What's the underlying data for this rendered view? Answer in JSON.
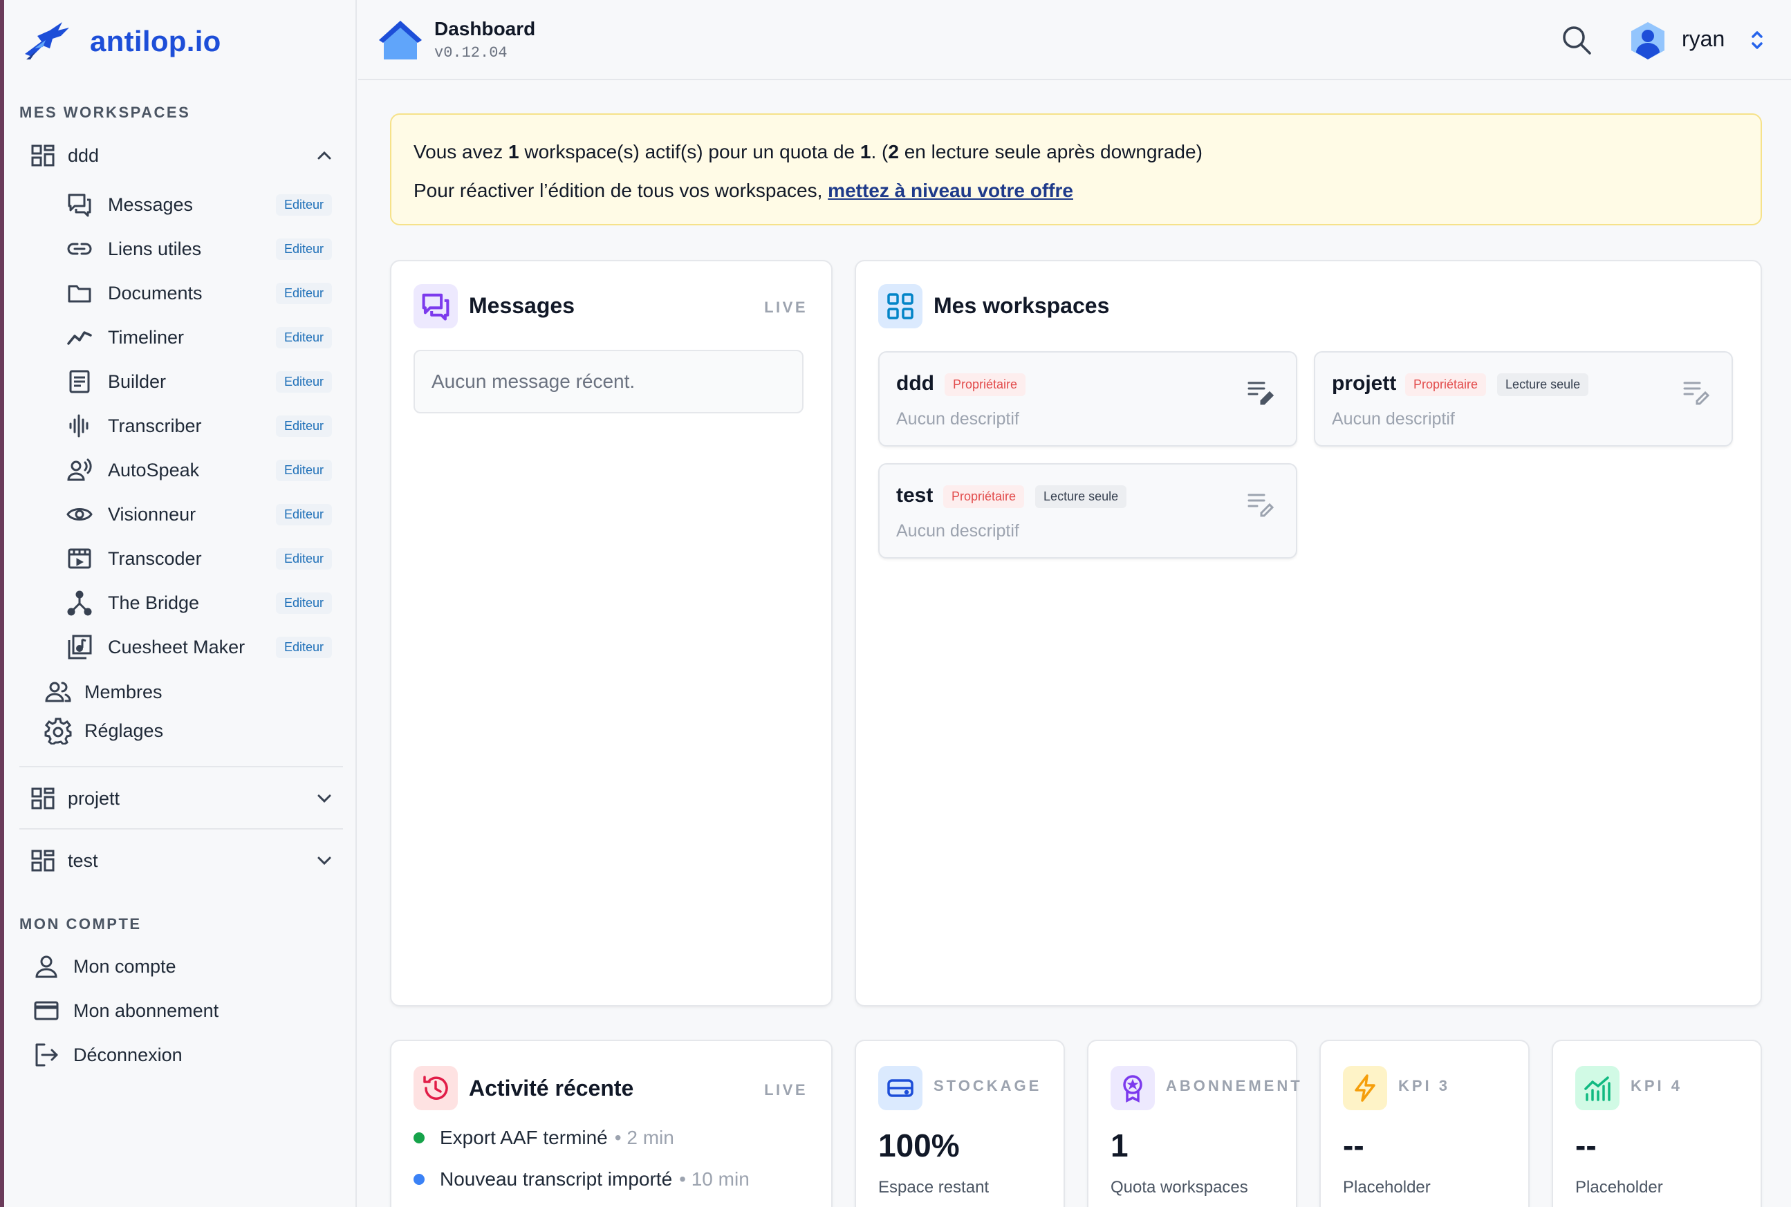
{
  "brand": {
    "name": "antilop.io"
  },
  "sidebar": {
    "workspaces_label": "MES WORKSPACES",
    "account_label": "MON COMPTE",
    "workspaces": [
      {
        "name": "ddd",
        "expanded": true
      },
      {
        "name": "projett",
        "expanded": false
      },
      {
        "name": "test",
        "expanded": false
      }
    ],
    "tools": [
      {
        "label": "Messages",
        "badge": "Editeur",
        "icon": "chat-icon"
      },
      {
        "label": "Liens utiles",
        "badge": "Editeur",
        "icon": "link-icon"
      },
      {
        "label": "Documents",
        "badge": "Editeur",
        "icon": "folder-icon"
      },
      {
        "label": "Timeliner",
        "badge": "Editeur",
        "icon": "trend-icon"
      },
      {
        "label": "Builder",
        "badge": "Editeur",
        "icon": "document-icon"
      },
      {
        "label": "Transcriber",
        "badge": "Editeur",
        "icon": "waveform-icon"
      },
      {
        "label": "AutoSpeak",
        "badge": "Editeur",
        "icon": "speaking-user-icon"
      },
      {
        "label": "Visionneur",
        "badge": "Editeur",
        "icon": "eye-icon"
      },
      {
        "label": "Transcoder",
        "badge": "Editeur",
        "icon": "film-icon"
      },
      {
        "label": "The Bridge",
        "badge": "Editeur",
        "icon": "network-icon"
      },
      {
        "label": "Cuesheet Maker",
        "badge": "Editeur",
        "icon": "music-sheet-icon"
      }
    ],
    "members_label": "Membres",
    "settings_label": "Réglages",
    "account_items": [
      {
        "label": "Mon compte",
        "icon": "user-icon"
      },
      {
        "label": "Mon abonnement",
        "icon": "credit-card-icon"
      },
      {
        "label": "Déconnexion",
        "icon": "logout-icon"
      }
    ]
  },
  "header": {
    "title": "Dashboard",
    "version": "v0.12.04",
    "username": "ryan"
  },
  "alert": {
    "l1_a": "Vous avez ",
    "l1_count": "1",
    "l1_b": " workspace(s) actif(s) pour un quota de ",
    "l1_quota": "1",
    "l1_c": ".  (",
    "l1_ro": "2",
    "l1_d": " en lecture seule après downgrade)",
    "l2_text": "Pour réactiver l’édition de tous vos workspaces, ",
    "l2_link": "mettez à niveau votre offre"
  },
  "messages_card": {
    "title": "Messages",
    "live": "LIVE",
    "empty": "Aucun message récent."
  },
  "workspaces_card": {
    "title": "Mes workspaces",
    "items": [
      {
        "name": "ddd",
        "owner": "Propriétaire",
        "readonly": "",
        "desc": "Aucun descriptif"
      },
      {
        "name": "projett",
        "owner": "Propriétaire",
        "readonly": "Lecture seule",
        "desc": "Aucun descriptif"
      },
      {
        "name": "test",
        "owner": "Propriétaire",
        "readonly": "Lecture seule",
        "desc": "Aucun descriptif"
      }
    ]
  },
  "activity_card": {
    "title": "Activité récente",
    "live": "LIVE",
    "items": [
      {
        "text": "Export AAF terminé",
        "time": "• 2 min",
        "color": "#16a34a"
      },
      {
        "text": "Nouveau transcript importé",
        "time": "• 10 min",
        "color": "#3b82f6"
      }
    ]
  },
  "kpis": [
    {
      "label": "STOCKAGE",
      "value": "100%",
      "sub": "Espace restant",
      "icon": "drive-icon",
      "bg": "#dbeafe",
      "color": "#1d4ed8"
    },
    {
      "label": "ABONNEMENT",
      "value": "1",
      "sub": "Quota workspaces",
      "icon": "award-icon",
      "bg": "#ede9fe",
      "color": "#7c3aed"
    },
    {
      "label": "KPI 3",
      "value": "--",
      "sub": "Placeholder",
      "icon": "bolt-icon",
      "bg": "#fef3c7",
      "color": "#f59e0b"
    },
    {
      "label": "KPI 4",
      "value": "--",
      "sub": "Placeholder",
      "icon": "bar-chart-icon",
      "bg": "#d1fae5",
      "color": "#10b981"
    }
  ]
}
